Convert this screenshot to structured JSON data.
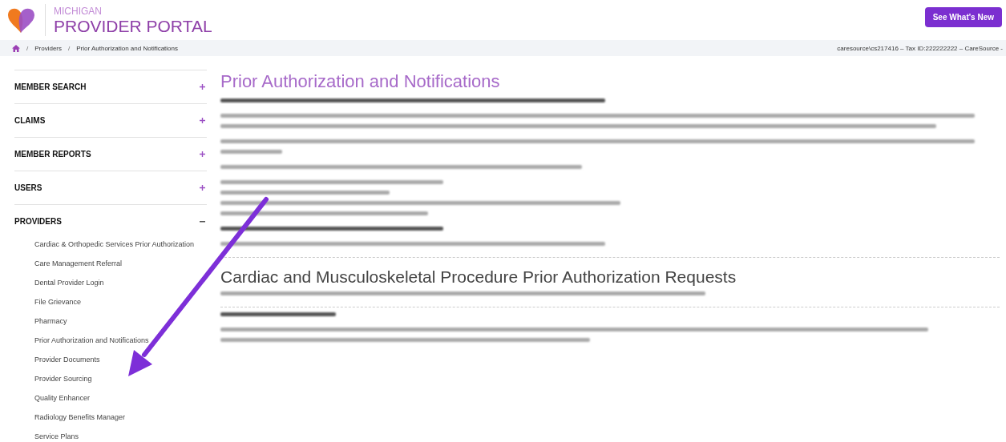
{
  "header": {
    "region": "MICHIGAN",
    "title": "PROVIDER PORTAL",
    "button": "See What's New"
  },
  "breadcrumb": {
    "items": [
      "Providers",
      "Prior Authorization and Notifications"
    ],
    "separator": "/",
    "account": "caresource\\cs217416 – Tax ID:222222222 – CareSource -"
  },
  "sidebar": {
    "sections": [
      {
        "label": "MEMBER SEARCH",
        "expanded": false
      },
      {
        "label": "CLAIMS",
        "expanded": false
      },
      {
        "label": "MEMBER REPORTS",
        "expanded": false
      },
      {
        "label": "USERS",
        "expanded": false
      },
      {
        "label": "PROVIDERS",
        "expanded": true,
        "children": [
          "Cardiac & Orthopedic Services Prior Authorization",
          "Care Management Referral",
          "Dental Provider Login",
          "File Grievance",
          "Pharmacy",
          "Prior Authorization and Notifications",
          "Provider Documents",
          "Provider Sourcing",
          "Quality Enhancer",
          "Radiology Benefits Manager",
          "Service Plans"
        ]
      }
    ]
  },
  "main": {
    "title": "Prior Authorization and Notifications",
    "section_heading": "Cardiac and Musculoskeletal Procedure Prior Authorization Requests"
  }
}
